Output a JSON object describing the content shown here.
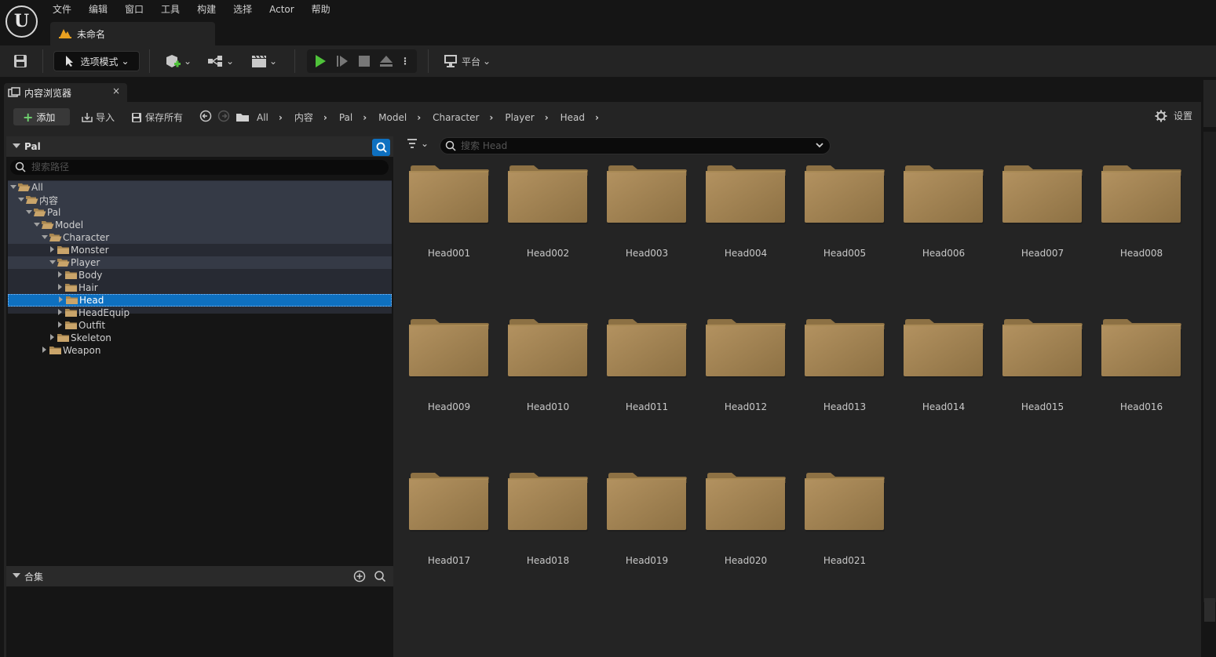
{
  "app": {
    "logo": "U",
    "menu": [
      "文件",
      "编辑",
      "窗口",
      "工具",
      "构建",
      "选择",
      "Actor",
      "帮助"
    ],
    "document_tab": "未命名"
  },
  "toolbar": {
    "save_icon": "save-icon",
    "mode_label": "选项模式",
    "platform_label": "平台"
  },
  "content_browser": {
    "tab_label": "内容浏览器",
    "close": "×",
    "add_label": "添加",
    "import_label": "导入",
    "save_all_label": "保存所有",
    "settings_label": "设置",
    "breadcrumb": [
      "All",
      "内容",
      "Pal",
      "Model",
      "Character",
      "Player",
      "Head"
    ],
    "sources": {
      "title": "Pal",
      "search_placeholder": "搜索路径",
      "tree": [
        {
          "label": "All",
          "depth": 0,
          "expanded": true,
          "highlight": true
        },
        {
          "label": "内容",
          "depth": 1,
          "expanded": true,
          "highlight": true
        },
        {
          "label": "Pal",
          "depth": 2,
          "expanded": true,
          "highlight": true
        },
        {
          "label": "Model",
          "depth": 3,
          "expanded": true,
          "highlight": true
        },
        {
          "label": "Character",
          "depth": 4,
          "expanded": true,
          "highlight": true
        },
        {
          "label": "Monster",
          "depth": 5,
          "expanded": false,
          "highlight": false
        },
        {
          "label": "Player",
          "depth": 5,
          "expanded": true,
          "highlight": true
        },
        {
          "label": "Body",
          "depth": 6,
          "expanded": false,
          "highlight": false
        },
        {
          "label": "Hair",
          "depth": 6,
          "expanded": false,
          "highlight": false
        },
        {
          "label": "Head",
          "depth": 6,
          "expanded": false,
          "selected": true
        },
        {
          "label": "HeadEquip",
          "depth": 6,
          "expanded": false,
          "highlight": false
        },
        {
          "label": "Outfit",
          "depth": 6,
          "expanded": false,
          "highlight": false
        },
        {
          "label": "Skeleton",
          "depth": 5,
          "expanded": false,
          "highlight": false
        },
        {
          "label": "Weapon",
          "depth": 4,
          "expanded": false,
          "highlight": false
        }
      ]
    },
    "collections": {
      "title": "合集"
    },
    "asset_search_placeholder": "搜索 Head",
    "folders": [
      "Head001",
      "Head002",
      "Head003",
      "Head004",
      "Head005",
      "Head006",
      "Head007",
      "Head008",
      "Head009",
      "Head010",
      "Head011",
      "Head012",
      "Head013",
      "Head014",
      "Head015",
      "Head016",
      "Head017",
      "Head018",
      "Head019",
      "Head020",
      "Head021"
    ]
  },
  "colors": {
    "folder": "#a98a55",
    "folder_dark": "#8d7144",
    "selection": "#0e70c0",
    "play_green": "#4fc23a"
  }
}
